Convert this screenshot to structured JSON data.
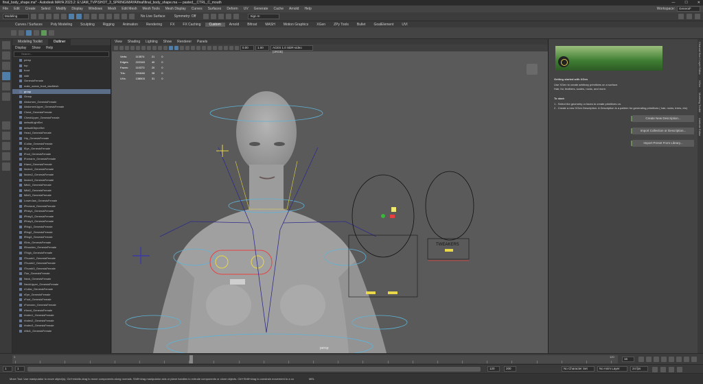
{
  "window": {
    "title": "final_body_shape.ma* - Autodesk MAYA 2023.2: E:\\JAM_TVP\\SHOT_3_SPRING\\MAYA\\final\\final_body_shape.ma  ---  pasted__CTRL_C_mouth"
  },
  "menubar": {
    "items": [
      "File",
      "Edit",
      "Create",
      "Select",
      "Modify",
      "Display",
      "Windows",
      "Mesh",
      "Edit Mesh",
      "Mesh Tools",
      "Mesh Display",
      "Curves",
      "Surfaces",
      "Deform",
      "UV",
      "Generate",
      "Cache",
      "Arnold",
      "Help"
    ],
    "workspace_label": "Workspace:",
    "workspace_value": "General*"
  },
  "statusline": {
    "mode": "Modeling",
    "no_live_surface": "No Live Surface",
    "symmetry": "Symmetry: Off",
    "sign_in": "Sign In"
  },
  "shelf": {
    "tabs": [
      "Curves / Surfaces",
      "Poly Modeling",
      "Sculpting",
      "Rigging",
      "Animation",
      "Rendering",
      "FX",
      "FX Caching",
      "Custom",
      "Arnold",
      "Bifrost",
      "MASH",
      "Motion Graphics",
      "XGen",
      "ZPy Tools",
      "Bullet",
      "GoalElement",
      "UVI"
    ],
    "active_tab": "Custom"
  },
  "outliner": {
    "tabs": [
      "Modeling Toolkit",
      "Outliner"
    ],
    "active_tab": "Outliner",
    "menu": [
      "Display",
      "Show",
      "Help"
    ],
    "search_placeholder": "Search...",
    "items": [
      "persp",
      "top",
      "front",
      "side",
      "GenesisFemale",
      "male_ocean_front_dazMesh",
      "group",
      "Group",
      "Abdomen_GenesisFemale",
      "AbdomenUpper_GenesisFemale",
      "Chest_GenesisFemale",
      "ChestUpper_GenesisFemale",
      "defaultLightSet",
      "defaultObjectSet",
      "Head_GenesisFemale",
      "Hip_GenesisFemale",
      "lCollar_GenesisFemale",
      "lEye_GenesisFemale",
      "lFoot_GenesisFemale",
      "lForearm_GenesisFemale",
      "lHand_GenesisFemale",
      "lIndex1_GenesisFemale",
      "lIndex2_GenesisFemale",
      "lIndex3_GenesisFemale",
      "lMid1_GenesisFemale",
      "lMid2_GenesisFemale",
      "lMid3_GenesisFemale",
      "LowerJaw_GenesisFemale",
      "lPectoral_GenesisFemale",
      "lPinky1_GenesisFemale",
      "lPinky2_GenesisFemale",
      "lPinky3_GenesisFemale",
      "lRing1_GenesisFemale",
      "lRing2_GenesisFemale",
      "lRing3_GenesisFemale",
      "lShin_GenesisFemale",
      "lShoulder_GenesisFemale",
      "lThigh_GenesisFemale",
      "lThumb1_GenesisFemale",
      "lThumb2_GenesisFemale",
      "lThumb3_GenesisFemale",
      "lToe_GenesisFemale",
      "Neck_GenesisFemale",
      "NeckUpper_GenesisFemale",
      "rCollar_GenesisFemale",
      "rEye_GenesisFemale",
      "rFoot_GenesisFemale",
      "rForearm_GenesisFemale",
      "rHand_GenesisFemale",
      "rIndex1_GenesisFemale",
      "rIndex2_GenesisFemale",
      "rIndex3_GenesisFemale",
      "rMid1_GenesisFemale"
    ],
    "selected_index": 6
  },
  "viewport": {
    "menu": [
      "View",
      "Shading",
      "Lighting",
      "Show",
      "Renderer",
      "Panels"
    ],
    "exposure": "0.00",
    "gamma": "1.00",
    "color_space": "ACES 1.0 SDR-video (sRGB)",
    "camera_label": "persp",
    "hud": [
      {
        "label": "Verts:",
        "a": "113574",
        "b": "21",
        "c": "0"
      },
      {
        "label": "Edges:",
        "a": "222345",
        "b": "40",
        "c": "0"
      },
      {
        "label": "Faces:",
        "a": "110373",
        "b": "20",
        "c": "0"
      },
      {
        "label": "Tris:",
        "a": "191646",
        "b": "28",
        "c": "0"
      },
      {
        "label": "UVs:",
        "a": "138503",
        "b": "31",
        "c": "0"
      }
    ],
    "tweakers_label": "TWEAKERS"
  },
  "xgen_panel": {
    "heading": "Getting started with XGen",
    "intro_lines": [
      "Use XGen to create arbitrary primitives on a surface.",
      "Hair, fur, feathers, scales, rocks, and more."
    ],
    "to_start": "To start:",
    "steps": [
      "1 - Select the geometry or faces to create primitives on.",
      "2 - Create a new XGen Description. A Description is a pattern for generating primitives ( hair, rocks, trees, etc)"
    ],
    "buttons": [
      "Create New Description...",
      "Import Collection or Description...",
      "Import Preset From Library..."
    ]
  },
  "side_tabs": [
    "Channel Box / Layer Editor",
    "XGen",
    "Modeling Toolkit",
    "Attribute Editor"
  ],
  "timeslider": {
    "start_label": "1",
    "end_label": "120",
    "current_frame": "16"
  },
  "rangeslider": {
    "start": "1",
    "start_inner": "1",
    "end_inner": "120",
    "end": "200",
    "character_set": "No Character Set",
    "anim_layer": "No Anim Layer",
    "fps": "24 fps"
  },
  "helpline": {
    "text": "Move Tool: Use manipulator to move object(s). Ctrl+middle-drag to move components along normals. Shift+drag manipulator axis or plane handles to extrude components or clone objects. Ctrl+Shift+drag to constrain movement to a co",
    "mel_label": "MEL"
  }
}
